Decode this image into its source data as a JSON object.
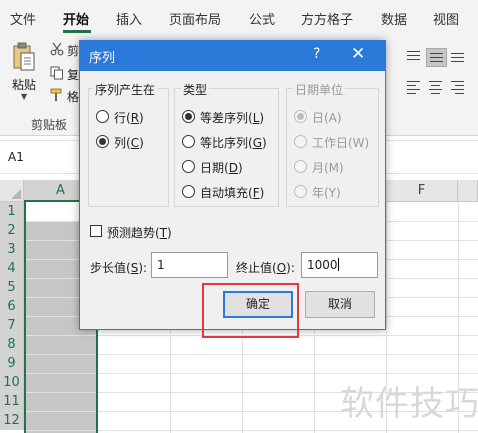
{
  "ribbon": {
    "tabs": [
      "文件",
      "开始",
      "插入",
      "页面布局",
      "公式",
      "方方格子",
      "数据",
      "视图"
    ],
    "active_tab": "开始",
    "clipboard": {
      "paste_label": "粘贴",
      "cut_label": "剪",
      "copy_label": "复",
      "format_label": "格",
      "group_label": "剪贴板"
    },
    "accent_color": "#217346"
  },
  "formula_bar": {
    "name_box": "A1"
  },
  "grid": {
    "columns": [
      "A",
      "F"
    ],
    "selected_column": "A",
    "rows": [
      "1",
      "2",
      "3",
      "4",
      "5",
      "6",
      "7",
      "8",
      "9",
      "10",
      "11",
      "12"
    ]
  },
  "dialog": {
    "title": "序列",
    "help_icon": "?",
    "close_icon": "✕",
    "series_in": {
      "label": "序列产生在",
      "options": [
        {
          "text": "行(",
          "key": "R",
          "suffix": ")",
          "selected": false
        },
        {
          "text": "列(",
          "key": "C",
          "suffix": ")",
          "selected": true
        }
      ]
    },
    "type": {
      "label": "类型",
      "options": [
        {
          "text": "等差序列(",
          "key": "L",
          "suffix": ")",
          "selected": true
        },
        {
          "text": "等比序列(",
          "key": "G",
          "suffix": ")",
          "selected": false
        },
        {
          "text": "日期(",
          "key": "D",
          "suffix": ")",
          "selected": false
        },
        {
          "text": "自动填充(",
          "key": "F",
          "suffix": ")",
          "selected": false
        }
      ]
    },
    "date_unit": {
      "label": "日期单位",
      "disabled": true,
      "options": [
        {
          "text": "日(A)",
          "selected": true
        },
        {
          "text": "工作日(W)",
          "selected": false
        },
        {
          "text": "月(M)",
          "selected": false
        },
        {
          "text": "年(Y)",
          "selected": false
        }
      ]
    },
    "trend": {
      "text": "预测趋势(",
      "key": "T",
      "suffix": ")",
      "checked": false
    },
    "step": {
      "text": "步长值(",
      "key": "S",
      "suffix": "):",
      "value": "1"
    },
    "stop": {
      "text": "终止值(",
      "key": "O",
      "suffix": "):",
      "value": "1000"
    },
    "ok_label": "确定",
    "cancel_label": "取消",
    "title_color": "#2b79d8",
    "highlight_color": "#e03a3a"
  },
  "watermark": "软件技巧"
}
